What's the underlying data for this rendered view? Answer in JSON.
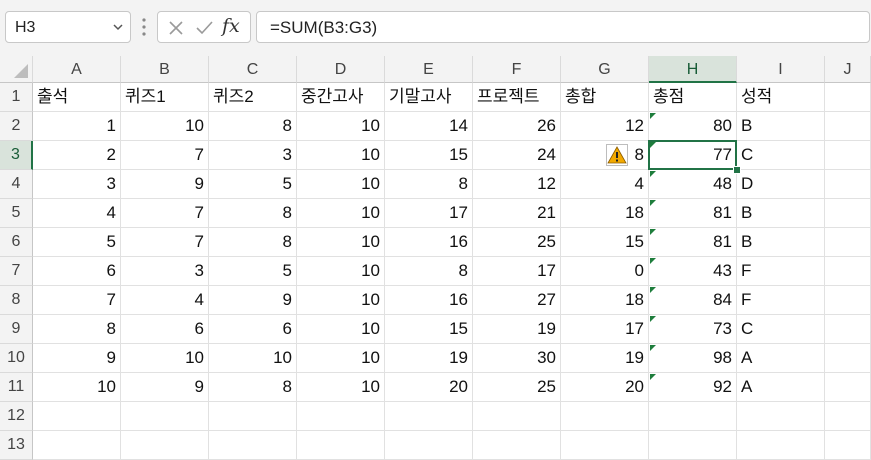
{
  "name_box": {
    "value": "H3"
  },
  "formula_bar": {
    "cancel_icon": "cancel-icon",
    "enter_icon": "check-icon",
    "fx_label": "fx",
    "formula": "=SUM(B3:G3)"
  },
  "columns": [
    "A",
    "B",
    "C",
    "D",
    "E",
    "F",
    "G",
    "H",
    "I",
    "J"
  ],
  "selected_cell": {
    "col": "H",
    "row": 3
  },
  "rows": [
    {
      "n": "1",
      "cells": [
        "출석",
        "퀴즈1",
        "퀴즈2",
        "중간고사",
        "기말고사",
        "프로젝트",
        "총합",
        "총점",
        "성적"
      ]
    },
    {
      "n": "2",
      "cells": [
        "1",
        "10",
        "8",
        "10",
        "14",
        "26",
        "12",
        "80",
        "B"
      ]
    },
    {
      "n": "3",
      "cells": [
        "2",
        "7",
        "3",
        "10",
        "15",
        "24",
        "8",
        "77",
        "C"
      ]
    },
    {
      "n": "4",
      "cells": [
        "3",
        "9",
        "5",
        "10",
        "8",
        "12",
        "4",
        "48",
        "D"
      ]
    },
    {
      "n": "5",
      "cells": [
        "4",
        "7",
        "8",
        "10",
        "17",
        "21",
        "18",
        "81",
        "B"
      ]
    },
    {
      "n": "6",
      "cells": [
        "5",
        "7",
        "8",
        "10",
        "16",
        "25",
        "15",
        "81",
        "B"
      ]
    },
    {
      "n": "7",
      "cells": [
        "6",
        "3",
        "5",
        "10",
        "8",
        "17",
        "0",
        "43",
        "F"
      ]
    },
    {
      "n": "8",
      "cells": [
        "7",
        "4",
        "9",
        "10",
        "16",
        "27",
        "18",
        "84",
        "F"
      ]
    },
    {
      "n": "9",
      "cells": [
        "8",
        "6",
        "6",
        "10",
        "15",
        "19",
        "17",
        "73",
        "C"
      ]
    },
    {
      "n": "10",
      "cells": [
        "9",
        "10",
        "10",
        "10",
        "19",
        "30",
        "19",
        "98",
        "A"
      ]
    },
    {
      "n": "11",
      "cells": [
        "10",
        "9",
        "8",
        "10",
        "20",
        "25",
        "20",
        "92",
        "A"
      ]
    },
    {
      "n": "12",
      "cells": [
        "",
        "",
        "",
        "",
        "",
        "",
        "",
        "",
        ""
      ]
    },
    {
      "n": "13",
      "cells": [
        "",
        "",
        "",
        "",
        "",
        "",
        "",
        "",
        ""
      ]
    }
  ],
  "error_indicator": {
    "icon": "warning-icon",
    "cell": "G3",
    "color": "#f2a900"
  },
  "accent_color": "#217346"
}
